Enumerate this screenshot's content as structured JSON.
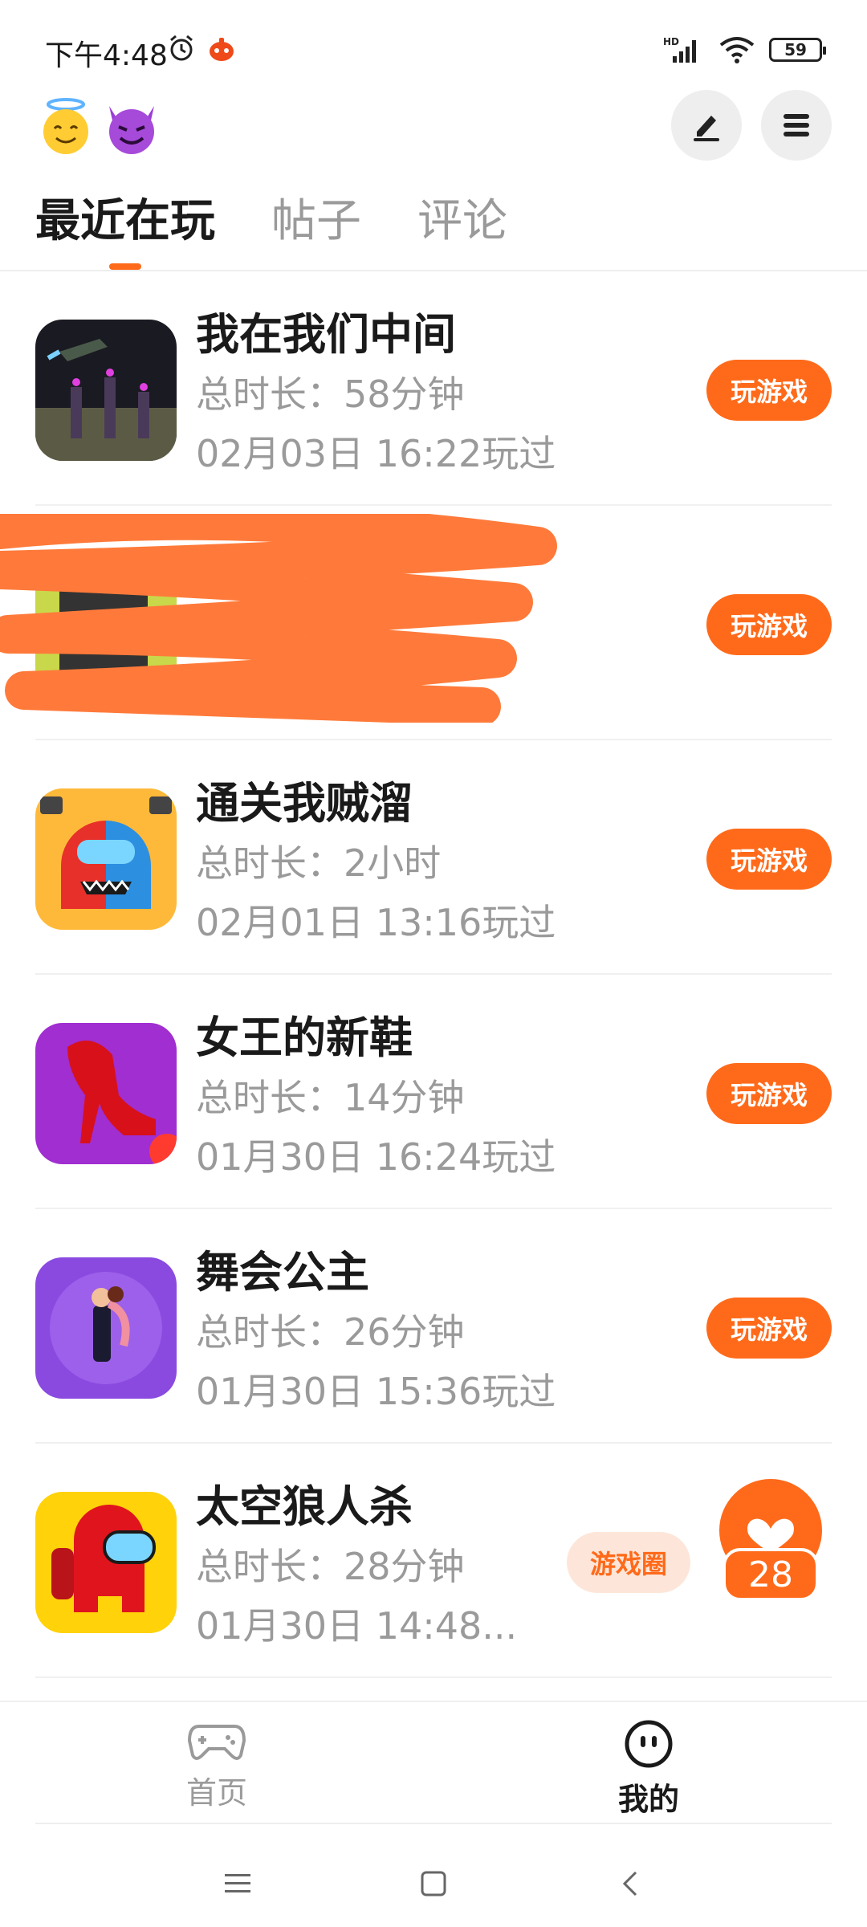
{
  "status_bar": {
    "time": "下午4:48",
    "network": "HD",
    "battery": "59"
  },
  "header": {
    "left_icons": [
      "smiling-face-with-halo-icon",
      "smiling-devil-icon"
    ],
    "edit_icon": "edit-icon",
    "menu_icon": "menu-icon"
  },
  "tabs": [
    {
      "label": "最近在玩",
      "active": true
    },
    {
      "label": "帖子",
      "active": false
    },
    {
      "label": "评论",
      "active": false
    }
  ],
  "games": [
    {
      "title": "我在我们中间",
      "duration": "总时长：58分钟",
      "last_played": "02月03日 16:22玩过",
      "button": "玩游戏"
    },
    {
      "title": "",
      "duration": "",
      "last_played": "",
      "button": "玩游戏"
    },
    {
      "title": "通关我贼溜",
      "duration": "总时长：2小时",
      "last_played": "02月01日 13:16玩过",
      "button": "玩游戏"
    },
    {
      "title": "女王的新鞋",
      "duration": "总时长：14分钟",
      "last_played": "01月30日 16:24玩过",
      "button": "玩游戏"
    },
    {
      "title": "舞会公主",
      "duration": "总时长：26分钟",
      "last_played": "01月30日 15:36玩过",
      "button": "玩游戏"
    },
    {
      "title": "太空狼人杀",
      "duration": "总时长：28分钟",
      "last_played": "01月30日 14:48...",
      "button": "游戏圈",
      "likes": "28"
    }
  ],
  "bottom_nav": [
    {
      "label": "首页",
      "icon": "gamepad-icon"
    },
    {
      "label": "我的",
      "icon": "face-icon"
    }
  ],
  "colors": {
    "accent": "#ff6a1a",
    "pill_bg": "#fde6d9",
    "muted_text": "#9a9a9a"
  }
}
